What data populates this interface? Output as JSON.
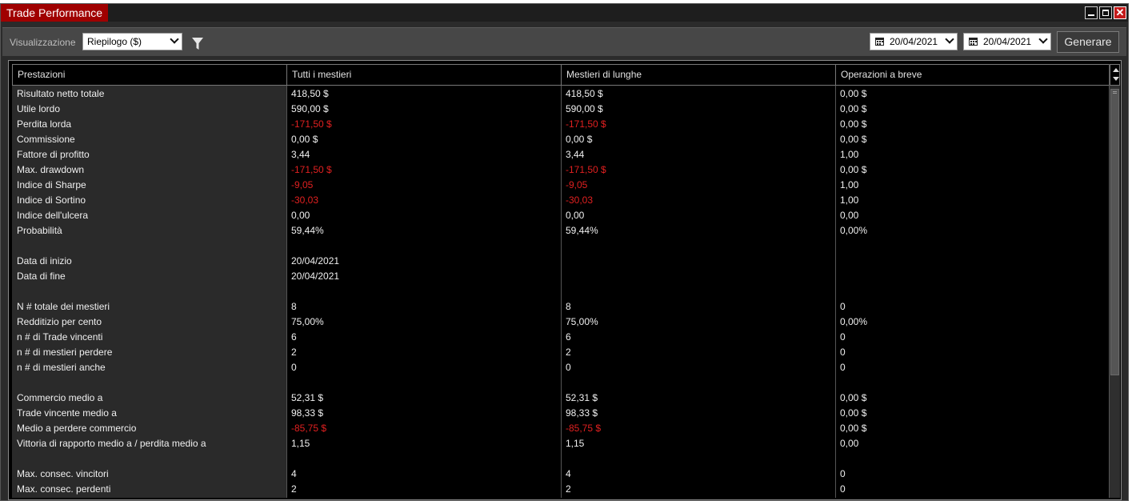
{
  "window": {
    "title": "Trade Performance",
    "close_glyph": "✕"
  },
  "toolbar": {
    "view_label": "Visualizzazione",
    "view_select": "Riepilogo ($)",
    "date_from": "20/04/2021",
    "date_to": "20/04/2021",
    "generate_label": "Generare"
  },
  "icons": {
    "filter": "filter-icon",
    "calendar": "calendar-icon",
    "chevron": "chevron-down-icon"
  },
  "colors": {
    "title_accent": "#a00000",
    "negative": "#e02020"
  },
  "table": {
    "headers": [
      "Prestazioni",
      "Tutti i mestieri",
      "Mestieri di lunghe",
      "Operazioni a breve"
    ],
    "rows": [
      {
        "label": "Risultato netto totale",
        "all": "418,50 $",
        "long": "418,50 $",
        "short": "0,00 $",
        "neg": [
          false,
          false,
          false
        ]
      },
      {
        "label": "Utile lordo",
        "all": "590,00 $",
        "long": "590,00 $",
        "short": "0,00 $",
        "neg": [
          false,
          false,
          false
        ]
      },
      {
        "label": "Perdita lorda",
        "all": "-171,50 $",
        "long": "-171,50 $",
        "short": "0,00 $",
        "neg": [
          true,
          true,
          false
        ]
      },
      {
        "label": "Commissione",
        "all": "0,00 $",
        "long": "0,00 $",
        "short": "0,00 $",
        "neg": [
          false,
          false,
          false
        ]
      },
      {
        "label": "Fattore di profitto",
        "all": "3,44",
        "long": "3,44",
        "short": "1,00",
        "neg": [
          false,
          false,
          false
        ]
      },
      {
        "label": "Max. drawdown",
        "all": "-171,50 $",
        "long": "-171,50 $",
        "short": "0,00 $",
        "neg": [
          true,
          true,
          false
        ]
      },
      {
        "label": "Indice di Sharpe",
        "all": "-9,05",
        "long": "-9,05",
        "short": "1,00",
        "neg": [
          true,
          true,
          false
        ]
      },
      {
        "label": "Indice di Sortino",
        "all": "-30,03",
        "long": "-30,03",
        "short": "1,00",
        "neg": [
          true,
          true,
          false
        ]
      },
      {
        "label": "Indice dell'ulcera",
        "all": "0,00",
        "long": "0,00",
        "short": "0,00",
        "neg": [
          false,
          false,
          false
        ]
      },
      {
        "label": "Probabilità",
        "all": "59,44%",
        "long": "59,44%",
        "short": "0,00%",
        "neg": [
          false,
          false,
          false
        ]
      },
      {
        "label": "",
        "all": "",
        "long": "",
        "short": "",
        "neg": [
          false,
          false,
          false
        ]
      },
      {
        "label": "Data di inizio",
        "all": "20/04/2021",
        "long": "",
        "short": "",
        "neg": [
          false,
          false,
          false
        ]
      },
      {
        "label": "Data di fine",
        "all": "20/04/2021",
        "long": "",
        "short": "",
        "neg": [
          false,
          false,
          false
        ]
      },
      {
        "label": "",
        "all": "",
        "long": "",
        "short": "",
        "neg": [
          false,
          false,
          false
        ]
      },
      {
        "label": "N # totale dei mestieri",
        "all": "8",
        "long": "8",
        "short": "0",
        "neg": [
          false,
          false,
          false
        ]
      },
      {
        "label": "Redditizio per cento",
        "all": "75,00%",
        "long": "75,00%",
        "short": "0,00%",
        "neg": [
          false,
          false,
          false
        ]
      },
      {
        "label": "n # di Trade vincenti",
        "all": "6",
        "long": "6",
        "short": "0",
        "neg": [
          false,
          false,
          false
        ]
      },
      {
        "label": "n # di mestieri perdere",
        "all": "2",
        "long": "2",
        "short": "0",
        "neg": [
          false,
          false,
          false
        ]
      },
      {
        "label": "n # di mestieri anche",
        "all": "0",
        "long": "0",
        "short": "0",
        "neg": [
          false,
          false,
          false
        ]
      },
      {
        "label": "",
        "all": "",
        "long": "",
        "short": "",
        "neg": [
          false,
          false,
          false
        ]
      },
      {
        "label": "Commercio medio a",
        "all": "52,31 $",
        "long": "52,31 $",
        "short": "0,00 $",
        "neg": [
          false,
          false,
          false
        ]
      },
      {
        "label": "Trade vincente medio a",
        "all": "98,33 $",
        "long": "98,33 $",
        "short": "0,00 $",
        "neg": [
          false,
          false,
          false
        ]
      },
      {
        "label": "Medio a perdere commercio",
        "all": "-85,75 $",
        "long": "-85,75 $",
        "short": "0,00 $",
        "neg": [
          true,
          true,
          false
        ]
      },
      {
        "label": "Vittoria di rapporto medio a / perdita medio a",
        "all": "1,15",
        "long": "1,15",
        "short": "0,00",
        "neg": [
          false,
          false,
          false
        ]
      },
      {
        "label": "",
        "all": "",
        "long": "",
        "short": "",
        "neg": [
          false,
          false,
          false
        ]
      },
      {
        "label": "Max. consec. vincitori",
        "all": "4",
        "long": "4",
        "short": "0",
        "neg": [
          false,
          false,
          false
        ]
      },
      {
        "label": "Max. consec. perdenti",
        "all": "2",
        "long": "2",
        "short": "0",
        "neg": [
          false,
          false,
          false
        ]
      }
    ]
  }
}
